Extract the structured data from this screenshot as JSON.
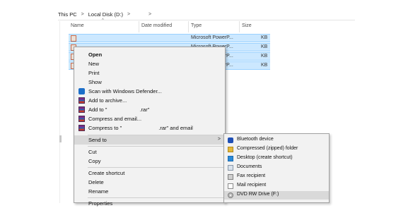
{
  "breadcrumb": {
    "root": "This PC",
    "sep1": ">",
    "drive": "Local Disk (D:)",
    "sep2": ">",
    "sep3": ">"
  },
  "columns": {
    "name": "Name",
    "date": "Date modified",
    "type": "Type",
    "size": "Size"
  },
  "files": [
    {
      "type": "Microsoft PowerP...",
      "size": "KB"
    },
    {
      "type": "Microsoft PowerP...",
      "size": "KB"
    },
    {
      "type": "Microsoft PowerP...",
      "size": "KB"
    },
    {
      "type": "Microsoft PowerP...",
      "size": "KB"
    }
  ],
  "context_menu": {
    "open": "Open",
    "new": "New",
    "print": "Print",
    "show": "Show",
    "scan": "Scan with Windows Defender...",
    "add_archive": "Add to archive...",
    "add_to_rar_prefix": "Add to \"",
    "add_to_rar_suffix": ".rar\"",
    "compress_email": "Compress and email...",
    "compress_to_prefix": "Compress to \"",
    "compress_to_suffix": ".rar\" and email",
    "send_to": "Send to",
    "send_to_arrow": ">",
    "cut": "Cut",
    "copy": "Copy",
    "create_shortcut": "Create shortcut",
    "delete": "Delete",
    "rename": "Rename",
    "properties": "Properties"
  },
  "send_to_menu": {
    "bluetooth": "Bluetooth device",
    "compressed": "Compressed (zipped) folder",
    "desktop": "Desktop (create shortcut)",
    "documents": "Documents",
    "fax": "Fax recipient",
    "mail": "Mail recipient",
    "dvd": "DVD RW Drive (F:)"
  },
  "colors": {
    "selection": "#cce8ff",
    "selection_border": "#99d1ff",
    "menu_bg": "#f2f2f2",
    "menu_highlight": "#d9d9d9"
  }
}
